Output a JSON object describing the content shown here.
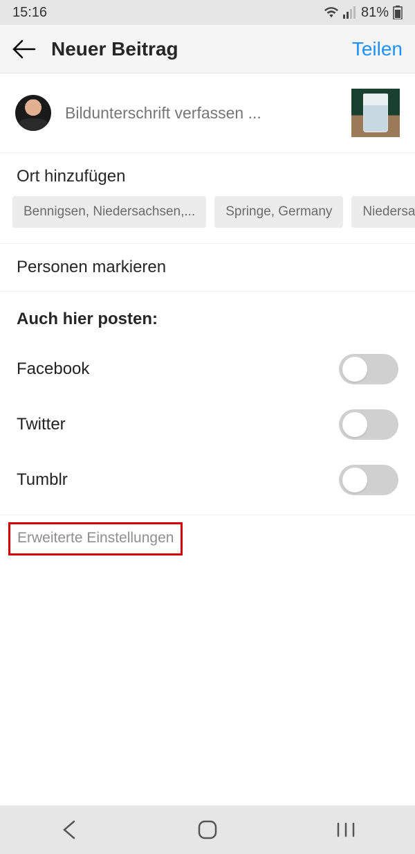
{
  "status": {
    "time": "15:16",
    "battery": "81%"
  },
  "header": {
    "title": "Neuer Beitrag",
    "share": "Teilen"
  },
  "compose": {
    "placeholder": "Bildunterschrift verfassen ..."
  },
  "location": {
    "label": "Ort hinzufügen",
    "suggestions": [
      "Bennigsen, Niedersachsen,...",
      "Springe, Germany",
      "Niedersachsen, Ge"
    ]
  },
  "tag": {
    "label": "Personen markieren"
  },
  "crosspost": {
    "title": "Auch hier posten:",
    "options": [
      {
        "label": "Facebook",
        "on": false
      },
      {
        "label": "Twitter",
        "on": false
      },
      {
        "label": "Tumblr",
        "on": false
      }
    ]
  },
  "advanced": {
    "label": "Erweiterte Einstellungen"
  }
}
